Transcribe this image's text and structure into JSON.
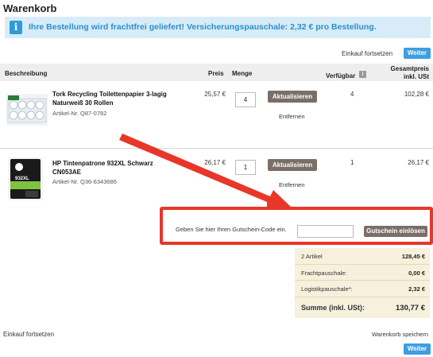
{
  "page": {
    "title": "Warenkorb"
  },
  "banner": {
    "icon": "info-icon",
    "text": "Ihre Bestellung wird frachtfrei geliefert! Versicherungspauschale: 2,32 € pro Bestellung."
  },
  "top_actions": {
    "continue_label": "Einkauf fortsetzen",
    "next_label": "Weiter"
  },
  "table_header": {
    "description": "Beschreibung",
    "price": "Preis",
    "quantity": "Menge",
    "availability": "Verfügbar",
    "total_line1": "Gesamtpreis",
    "total_line2": "inkl. USt"
  },
  "items": [
    {
      "name_line1": "Tork Recycling Toilettenpapier 3-lagig",
      "name_line2": "Naturweiß 30 Rollen",
      "article": "Artikel-Nr. Q87-0782",
      "price": "25,57 €",
      "quantity": "4",
      "update_label": "Aktualisieren",
      "remove_label": "Entfernen",
      "available": "4",
      "total": "102,28 €"
    },
    {
      "name_line1": "HP Tintenpatrone 932XL Schwarz",
      "name_line2": "CN053AE",
      "article": "Artikel-Nr. Q36-6343686",
      "price": "26,17 €",
      "quantity": "1",
      "update_label": "Aktualisieren",
      "remove_label": "Entfernen",
      "available": "1",
      "total": "26,17 €",
      "image_badge": "932XL"
    }
  ],
  "coupon": {
    "label": "Geben Sie hier Ihren Gutschein-Code ein.",
    "value": "",
    "button_label": "Gutschein einlösen"
  },
  "summary": {
    "items_label": "2 Artikel",
    "items_value": "128,45 €",
    "freight_label": "Frachtpauschale:",
    "freight_value": "0,00 €",
    "logistics_label": "Logistikpauschale*:",
    "logistics_value": "2,32 €",
    "total_label": "Summe (inkl. USt):",
    "total_value": "130,77 €"
  },
  "bottom_actions": {
    "continue_label": "Einkauf fortsetzen",
    "save_label": "Warenkorb speichern",
    "next_label": "Weiter"
  },
  "colors": {
    "accent_blue": "#3d9ee1",
    "banner_bg": "#d7ecf8",
    "highlight_red": "#e8372a",
    "summary_bg": "#f7f0dc",
    "button_gray": "#7a6e66"
  }
}
